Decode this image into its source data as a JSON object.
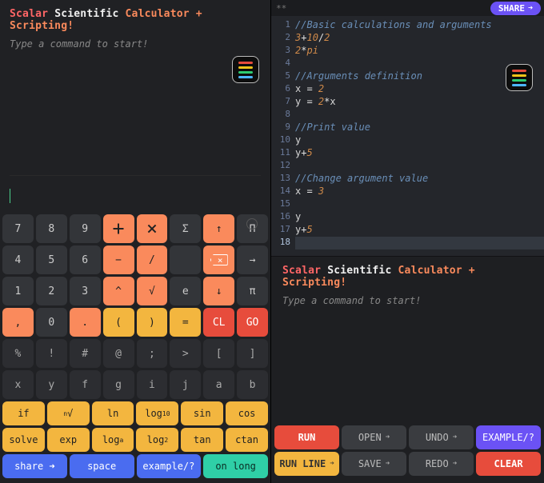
{
  "brand": {
    "part1": "Scalar",
    "part2": "Scientific",
    "part3": "Calculator + Scripting!"
  },
  "hint": "Type a command to start!",
  "keypad": {
    "r1": [
      "7",
      "8",
      "9",
      "+",
      "*",
      "Σ",
      "↑",
      "Π"
    ],
    "r2": [
      "4",
      "5",
      "6",
      "−",
      "/",
      " ",
      "⌫",
      "→"
    ],
    "r3": [
      "1",
      "2",
      "3",
      "^",
      "√",
      "e",
      "↓",
      "π"
    ],
    "r4": [
      ",",
      "0",
      ".",
      "(",
      ")",
      "=",
      "CL",
      "GO"
    ],
    "r5": [
      "%",
      "!",
      "#",
      "@",
      ";",
      ">",
      "[",
      "]"
    ],
    "r6": [
      "x",
      "y",
      "f",
      "g",
      "i",
      "j",
      "a",
      "b"
    ]
  },
  "funcs": {
    "f1": [
      "if",
      "ⁿ√",
      "ln",
      "log₁₀",
      "sin",
      "cos"
    ],
    "f2": [
      "solve",
      "exp",
      "logₐ",
      "log₂",
      "tan",
      "ctan"
    ],
    "f3": [
      "share ➜",
      "space",
      "example/?",
      "on long"
    ]
  },
  "topbar": {
    "dirty": "**",
    "share": "SHARE"
  },
  "editor_lines": [
    {
      "n": 1,
      "cells": [
        {
          "cls": "cm",
          "t": "//Basic calculations and arguments"
        }
      ]
    },
    {
      "n": 2,
      "cells": [
        {
          "cls": "num",
          "t": "3"
        },
        {
          "cls": "op",
          "t": "+"
        },
        {
          "cls": "num",
          "t": "10"
        },
        {
          "cls": "op",
          "t": "/"
        },
        {
          "cls": "num",
          "t": "2"
        }
      ]
    },
    {
      "n": 3,
      "cells": [
        {
          "cls": "num",
          "t": "2"
        },
        {
          "cls": "op",
          "t": "*"
        },
        {
          "cls": "con",
          "t": "pi"
        }
      ]
    },
    {
      "n": 4,
      "cells": []
    },
    {
      "n": 5,
      "cells": [
        {
          "cls": "cm",
          "t": "//Arguments definition"
        }
      ]
    },
    {
      "n": 6,
      "cells": [
        {
          "cls": "var",
          "t": "x "
        },
        {
          "cls": "op",
          "t": "= "
        },
        {
          "cls": "num",
          "t": "2"
        }
      ]
    },
    {
      "n": 7,
      "cells": [
        {
          "cls": "var",
          "t": "y "
        },
        {
          "cls": "op",
          "t": "= "
        },
        {
          "cls": "num",
          "t": "2"
        },
        {
          "cls": "op",
          "t": "*"
        },
        {
          "cls": "var",
          "t": "x"
        }
      ]
    },
    {
      "n": 8,
      "cells": []
    },
    {
      "n": 9,
      "cells": [
        {
          "cls": "cm",
          "t": "//Print value"
        }
      ]
    },
    {
      "n": 10,
      "cells": [
        {
          "cls": "var",
          "t": "y"
        }
      ]
    },
    {
      "n": 11,
      "cells": [
        {
          "cls": "var",
          "t": "y"
        },
        {
          "cls": "op",
          "t": "+"
        },
        {
          "cls": "num",
          "t": "5"
        }
      ]
    },
    {
      "n": 12,
      "cells": []
    },
    {
      "n": 13,
      "cells": [
        {
          "cls": "cm",
          "t": "//Change argument value"
        }
      ]
    },
    {
      "n": 14,
      "cells": [
        {
          "cls": "var",
          "t": "x "
        },
        {
          "cls": "op",
          "t": "= "
        },
        {
          "cls": "num",
          "t": "3"
        }
      ]
    },
    {
      "n": 15,
      "cells": []
    },
    {
      "n": 16,
      "cells": [
        {
          "cls": "var",
          "t": "y"
        }
      ]
    },
    {
      "n": 17,
      "cells": [
        {
          "cls": "var",
          "t": "y"
        },
        {
          "cls": "op",
          "t": "+"
        },
        {
          "cls": "num",
          "t": "5"
        }
      ]
    },
    {
      "n": 18,
      "cells": [],
      "cursor": true
    }
  ],
  "actions": {
    "r1": [
      {
        "label": "RUN",
        "style": "red"
      },
      {
        "label": "OPEN",
        "style": "dark",
        "arrow": true
      },
      {
        "label": "UNDO",
        "style": "dark",
        "arrow": true
      },
      {
        "label": "EXAMPLE/?",
        "style": "purple"
      }
    ],
    "r2": [
      {
        "label": "RUN LINE",
        "style": "yellow",
        "arrow": true
      },
      {
        "label": "SAVE",
        "style": "dark",
        "arrow": true
      },
      {
        "label": "REDO",
        "style": "dark",
        "arrow": true
      },
      {
        "label": "CLEAR",
        "style": "red"
      }
    ]
  }
}
